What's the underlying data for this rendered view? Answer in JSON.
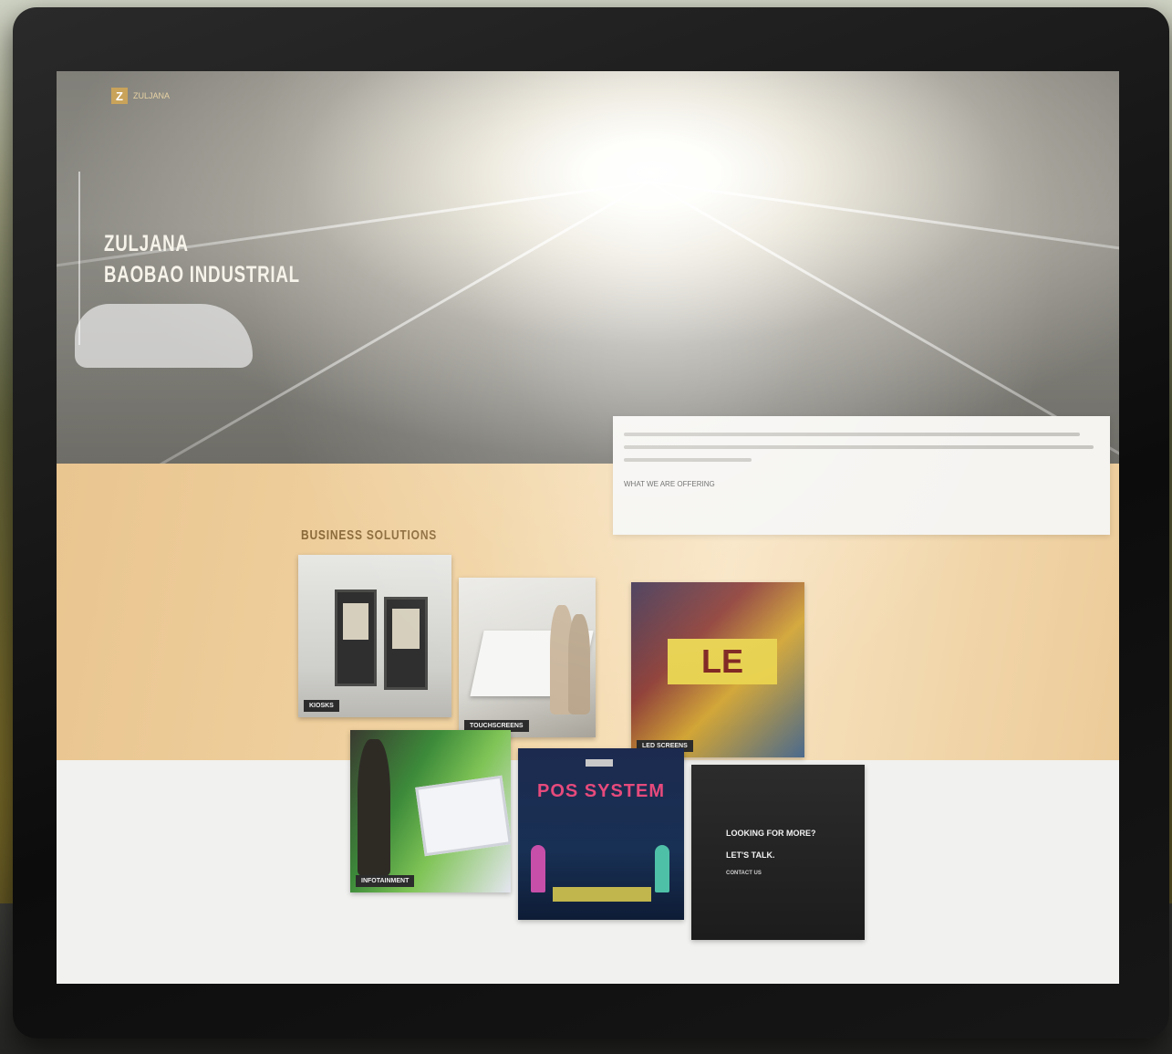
{
  "site": {
    "logo_mark": "Z",
    "logo_text": "ZULJANA"
  },
  "hero": {
    "title_line1": "ZULJANA",
    "title_line2": "BAOBAO INDUSTRIAL"
  },
  "intro": {
    "link_label": "WHAT WE ARE OFFERING"
  },
  "solutions": {
    "section_title": "BUSINESS SOLUTIONS",
    "tiles": [
      {
        "id": "kiosk",
        "label": "KIOSKS"
      },
      {
        "id": "touch",
        "label": "TOUCHSCREENS"
      },
      {
        "id": "led",
        "label": "LED SCREENS",
        "display_text": "LE"
      },
      {
        "id": "infotainment",
        "label": "INFOTAINMENT"
      },
      {
        "id": "pos",
        "title": "POS SYSTEM"
      },
      {
        "id": "more",
        "question": "LOOKING FOR MORE?",
        "cta": "LET'S TALK.",
        "contact": "CONTACT US"
      }
    ]
  },
  "colors": {
    "gold_band": "#eccb98",
    "accent": "#c9a35a",
    "pos_title": "#e74a7c"
  }
}
